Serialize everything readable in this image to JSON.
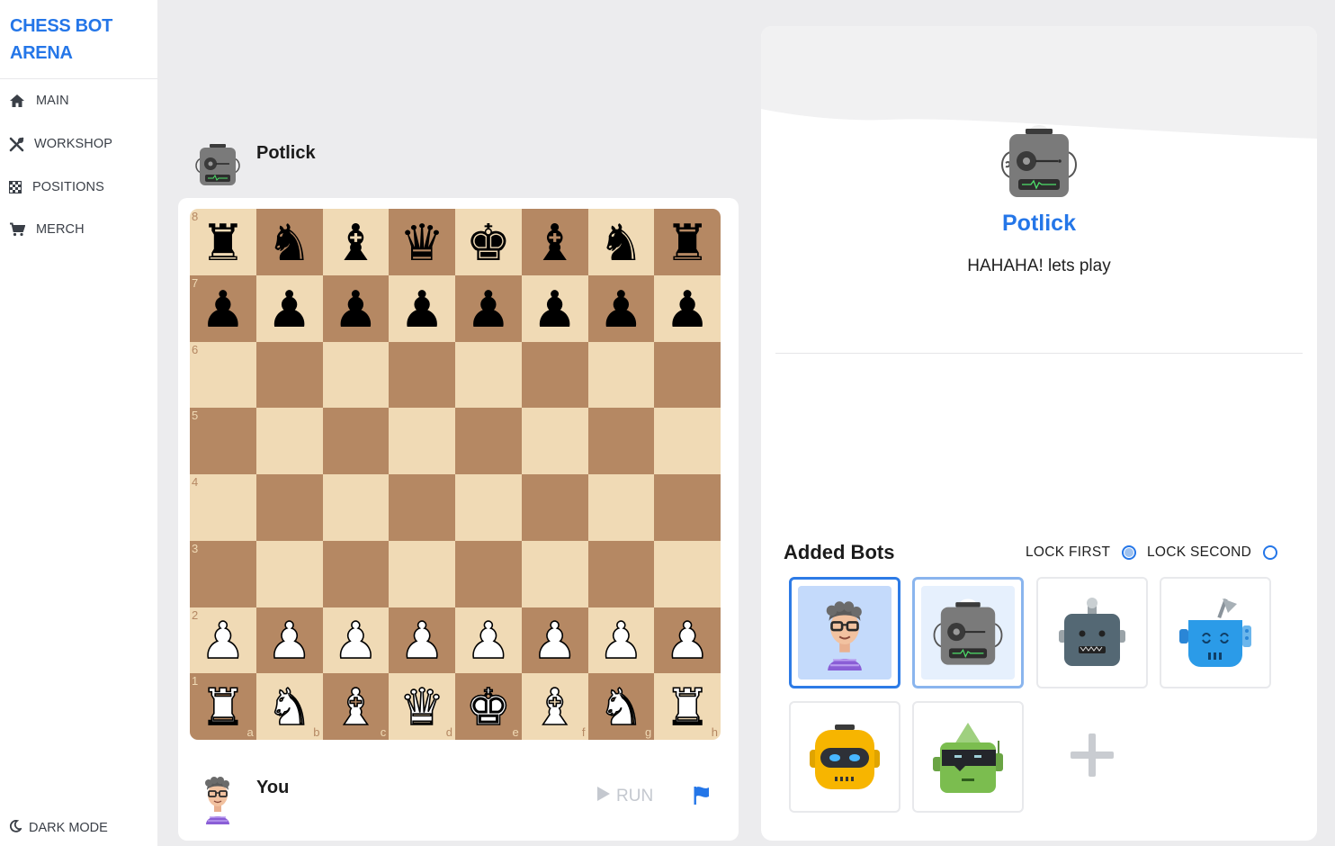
{
  "app": {
    "title_line1": "CHESS BOT",
    "title_line2": "ARENA"
  },
  "sidebar": {
    "items": [
      {
        "label": "MAIN",
        "icon": "home-icon"
      },
      {
        "label": "WORKSHOP",
        "icon": "tools-icon"
      },
      {
        "label": "POSITIONS",
        "icon": "checkerboard-icon"
      },
      {
        "label": "MERCH",
        "icon": "cart-icon"
      }
    ],
    "dark_mode": {
      "label": "DARK MODE",
      "icon": "moon-icon"
    }
  },
  "game": {
    "opponent_name": "Potlick",
    "player_name": "You",
    "run_label": "RUN",
    "ranks": [
      "8",
      "7",
      "6",
      "5",
      "4",
      "3",
      "2",
      "1"
    ],
    "files": [
      "a",
      "b",
      "c",
      "d",
      "e",
      "f",
      "g",
      "h"
    ],
    "position": [
      [
        "br",
        "bn",
        "bb",
        "bq",
        "bk",
        "bb",
        "bn",
        "br"
      ],
      [
        "bp",
        "bp",
        "bp",
        "bp",
        "bp",
        "bp",
        "bp",
        "bp"
      ],
      [
        "",
        "",
        "",
        "",
        "",
        "",
        "",
        ""
      ],
      [
        "",
        "",
        "",
        "",
        "",
        "",
        "",
        ""
      ],
      [
        "",
        "",
        "",
        "",
        "",
        "",
        "",
        ""
      ],
      [
        "",
        "",
        "",
        "",
        "",
        "",
        "",
        ""
      ],
      [
        "wp",
        "wp",
        "wp",
        "wp",
        "wp",
        "wp",
        "wp",
        "wp"
      ],
      [
        "wr",
        "wn",
        "wb",
        "wq",
        "wk",
        "wb",
        "wn",
        "wr"
      ]
    ]
  },
  "bot_panel": {
    "name": "Potlick",
    "message": "HAHAHA! lets play",
    "added_bots_title": "Added Bots",
    "lock_first_label": "LOCK FIRST",
    "lock_second_label": "LOCK SECOND",
    "lock_first_selected": true,
    "lock_second_selected": false,
    "bots": [
      {
        "name": "human-player",
        "icon": "human-avatar-icon",
        "state": "first"
      },
      {
        "name": "potlick",
        "icon": "gray-robot-icon",
        "state": "second"
      },
      {
        "name": "slate-robot",
        "icon": "slate-robot-icon",
        "state": "none"
      },
      {
        "name": "blue-robot",
        "icon": "blue-robot-icon",
        "state": "none"
      },
      {
        "name": "yellow-robot",
        "icon": "yellow-robot-icon",
        "state": "none"
      },
      {
        "name": "green-robot",
        "icon": "green-robot-icon",
        "state": "none"
      }
    ]
  },
  "colors": {
    "accent": "#2476e8",
    "board_light": "#f0dab5",
    "board_dark": "#b58863"
  }
}
